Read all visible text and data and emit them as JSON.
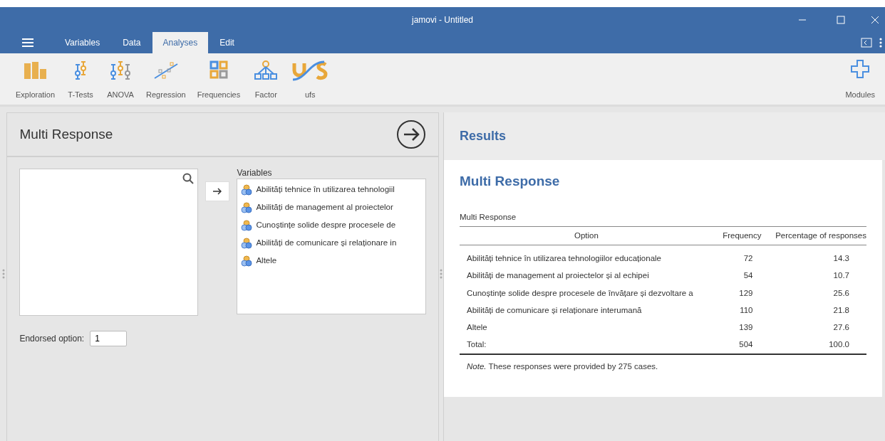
{
  "window": {
    "title": "jamovi - Untitled"
  },
  "tabs": [
    {
      "label": "Variables",
      "selected": false
    },
    {
      "label": "Data",
      "selected": false
    },
    {
      "label": "Analyses",
      "selected": true
    },
    {
      "label": "Edit",
      "selected": false
    }
  ],
  "toolbar": [
    {
      "label": "Exploration",
      "kind": "exploration"
    },
    {
      "label": "T-Tests",
      "kind": "ttests"
    },
    {
      "label": "ANOVA",
      "kind": "anova"
    },
    {
      "label": "Regression",
      "kind": "regression"
    },
    {
      "label": "Frequencies",
      "kind": "frequencies"
    },
    {
      "label": "Factor",
      "kind": "factor"
    },
    {
      "label": "ufs",
      "kind": "ufs"
    }
  ],
  "modules": {
    "label": "Modules"
  },
  "options_panel": {
    "title": "Multi Response",
    "variables_label": "Variables",
    "variables": [
      "Abilități tehnice în utilizarea tehnologiil",
      "Abilități de management al proiectelor",
      "Cunoștințe solide despre procesele de",
      "Abilități de comunicare și relaționare in",
      "Altele"
    ],
    "endorsed_label": "Endorsed option:",
    "endorsed_value": "1"
  },
  "results": {
    "heading": "Results",
    "title": "Multi Response",
    "table": {
      "caption": "Multi Response",
      "columns": [
        "Option",
        "Frequency",
        "Percentage of responses"
      ],
      "rows": [
        [
          "Abilități tehnice în utilizarea tehnologiilor educaționale",
          "72",
          "14.3"
        ],
        [
          "Abilități de management al proiectelor și al echipei",
          "54",
          "10.7"
        ],
        [
          "Cunoștințe solide despre procesele de învățare și dezvoltare a",
          "129",
          "25.6"
        ],
        [
          "Abilități de comunicare și relaționare interumană",
          "110",
          "21.8"
        ],
        [
          "Altele",
          "139",
          "27.6"
        ],
        [
          "Total:",
          "504",
          "100.0"
        ]
      ],
      "note": "*Note.* These responses were provided by 275 cases."
    }
  }
}
